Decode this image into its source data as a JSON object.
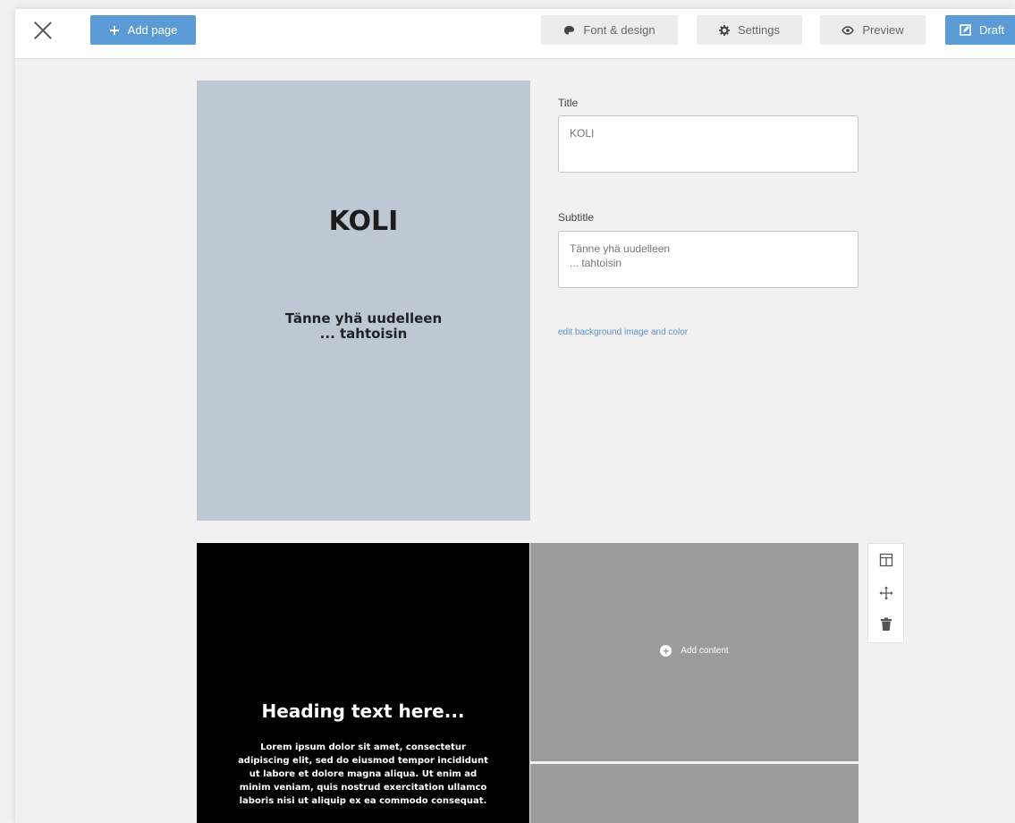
{
  "toolbar": {
    "add_page_label": "Add page",
    "font_design_label": "Font & design",
    "settings_label": "Settings",
    "preview_label": "Preview",
    "draft_label": "Draft"
  },
  "cover": {
    "title": "KOLI",
    "subtitle": "Tänne yhä uudelleen\n... tahtoisin"
  },
  "form": {
    "title_label": "Title",
    "title_value": "KOLI",
    "subtitle_label": "Subtitle",
    "subtitle_value": "Tänne yhä uudelleen\n... tahtoisin",
    "edit_background_link": "edit background image and color"
  },
  "page2": {
    "heading": "Heading text here...",
    "body": "Lorem ipsum dolor sit amet, consectetur adipiscing elit, sed do eiusmod tempor incididunt ut labore et dolore magna aliqua. Ut enim ad minim veniam, quis nostrud exercitation ullamco laboris nisi ut aliquip ex ea commodo consequat.",
    "add_content_label": "Add content"
  },
  "icons": [
    "close-icon",
    "plus-icon",
    "palette-icon",
    "gear-icon",
    "eye-icon",
    "edit-icon",
    "layout-icon",
    "move-icon",
    "trash-icon"
  ],
  "colors": {
    "accent": "#5b9bd5",
    "cover_background": "#bec8d2",
    "slot_background": "#9b9b9b",
    "link": "#5b8fc7"
  }
}
